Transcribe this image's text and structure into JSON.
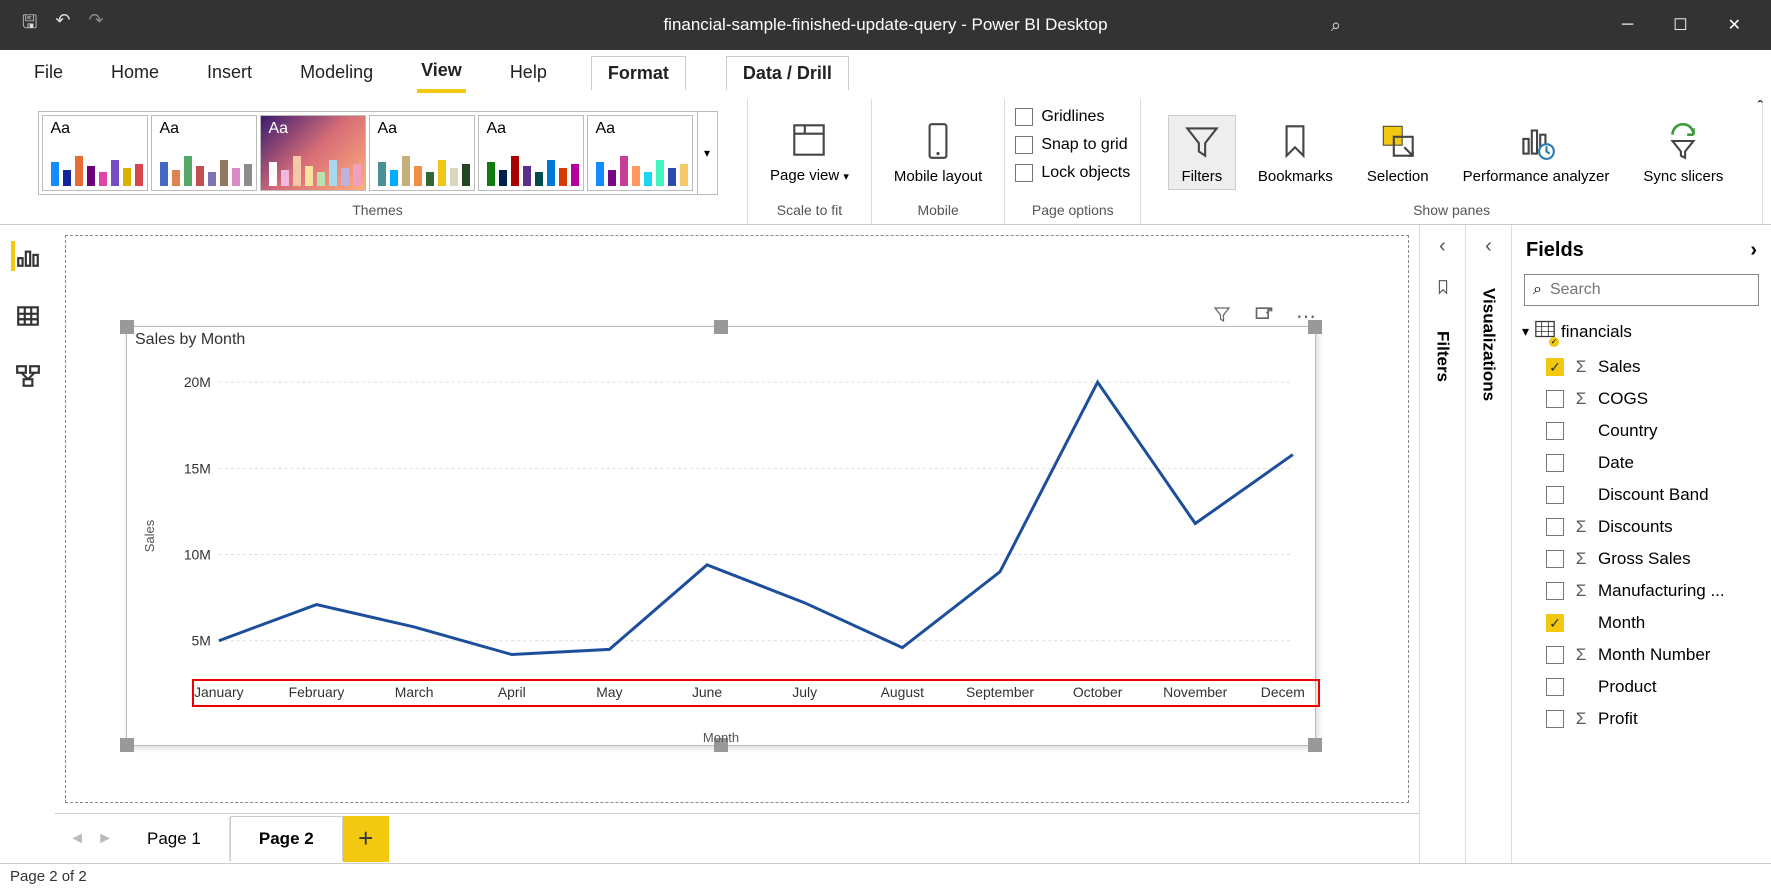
{
  "app_title": "financial-sample-finished-update-query - Power BI Desktop",
  "tabs": [
    "File",
    "Home",
    "Insert",
    "Modeling",
    "View",
    "Help",
    "Format",
    "Data / Drill"
  ],
  "active_tab": "View",
  "ribbon": {
    "themes_label": "Themes",
    "scale_label": "Scale to fit",
    "mobile_label": "Mobile",
    "page_options_label": "Page options",
    "show_panes_label": "Show panes",
    "page_view": "Page\nview",
    "mobile_layout": "Mobile\nlayout",
    "gridlines": "Gridlines",
    "snap": "Snap to grid",
    "lock": "Lock objects",
    "filters": "Filters",
    "bookmarks": "Bookmarks",
    "selection": "Selection",
    "perf": "Performance\nanalyzer",
    "sync": "Sync\nslicers"
  },
  "panes": {
    "filters": "Filters",
    "visualizations": "Visualizations",
    "fields": "Fields",
    "search_placeholder": "Search"
  },
  "fields_table": "financials",
  "fields": [
    {
      "name": "Sales",
      "checked": true,
      "sigma": true
    },
    {
      "name": "COGS",
      "checked": false,
      "sigma": true
    },
    {
      "name": "Country",
      "checked": false,
      "sigma": false
    },
    {
      "name": "Date",
      "checked": false,
      "sigma": false
    },
    {
      "name": "Discount Band",
      "checked": false,
      "sigma": false
    },
    {
      "name": "Discounts",
      "checked": false,
      "sigma": true
    },
    {
      "name": "Gross Sales",
      "checked": false,
      "sigma": true
    },
    {
      "name": "Manufacturing ...",
      "checked": false,
      "sigma": true
    },
    {
      "name": "Month",
      "checked": true,
      "sigma": false
    },
    {
      "name": "Month Number",
      "checked": false,
      "sigma": true
    },
    {
      "name": "Product",
      "checked": false,
      "sigma": false
    },
    {
      "name": "Profit",
      "checked": false,
      "sigma": true
    }
  ],
  "pages": [
    "Page 1",
    "Page 2"
  ],
  "active_page": 1,
  "status": "Page 2 of 2",
  "chart_data": {
    "type": "line",
    "title": "Sales by Month",
    "xlabel": "Month",
    "ylabel": "Sales",
    "categories": [
      "January",
      "February",
      "March",
      "April",
      "May",
      "June",
      "July",
      "August",
      "September",
      "October",
      "November",
      "December"
    ],
    "values": [
      5.0,
      7.1,
      5.8,
      4.2,
      4.5,
      9.4,
      7.2,
      4.6,
      9.0,
      20.0,
      11.8,
      15.8
    ],
    "y_ticks": [
      5,
      10,
      15,
      20
    ],
    "y_tick_labels": [
      "5M",
      "10M",
      "15M",
      "20M"
    ],
    "ylim": [
      3,
      21
    ]
  }
}
